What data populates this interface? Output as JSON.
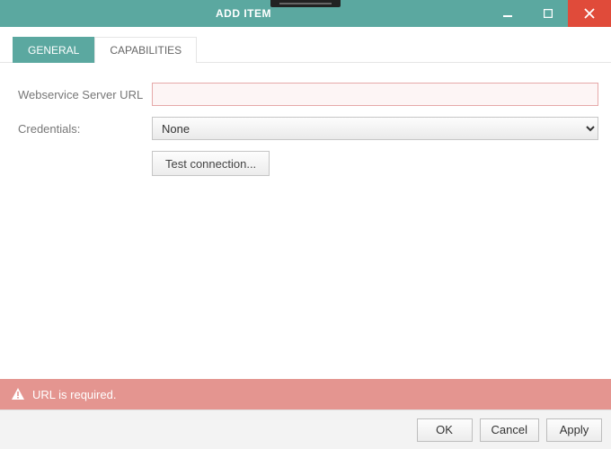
{
  "window": {
    "title": "ADD ITEM"
  },
  "tabs": {
    "general": "GENERAL",
    "capabilities": "CAPABILITIES"
  },
  "form": {
    "url_label": "Webservice Server URL",
    "url_value": "",
    "credentials_label": "Credentials:",
    "credentials_value": "None",
    "test_connection": "Test connection..."
  },
  "error": {
    "message": "URL is required."
  },
  "buttons": {
    "ok": "OK",
    "cancel": "Cancel",
    "apply": "Apply"
  }
}
